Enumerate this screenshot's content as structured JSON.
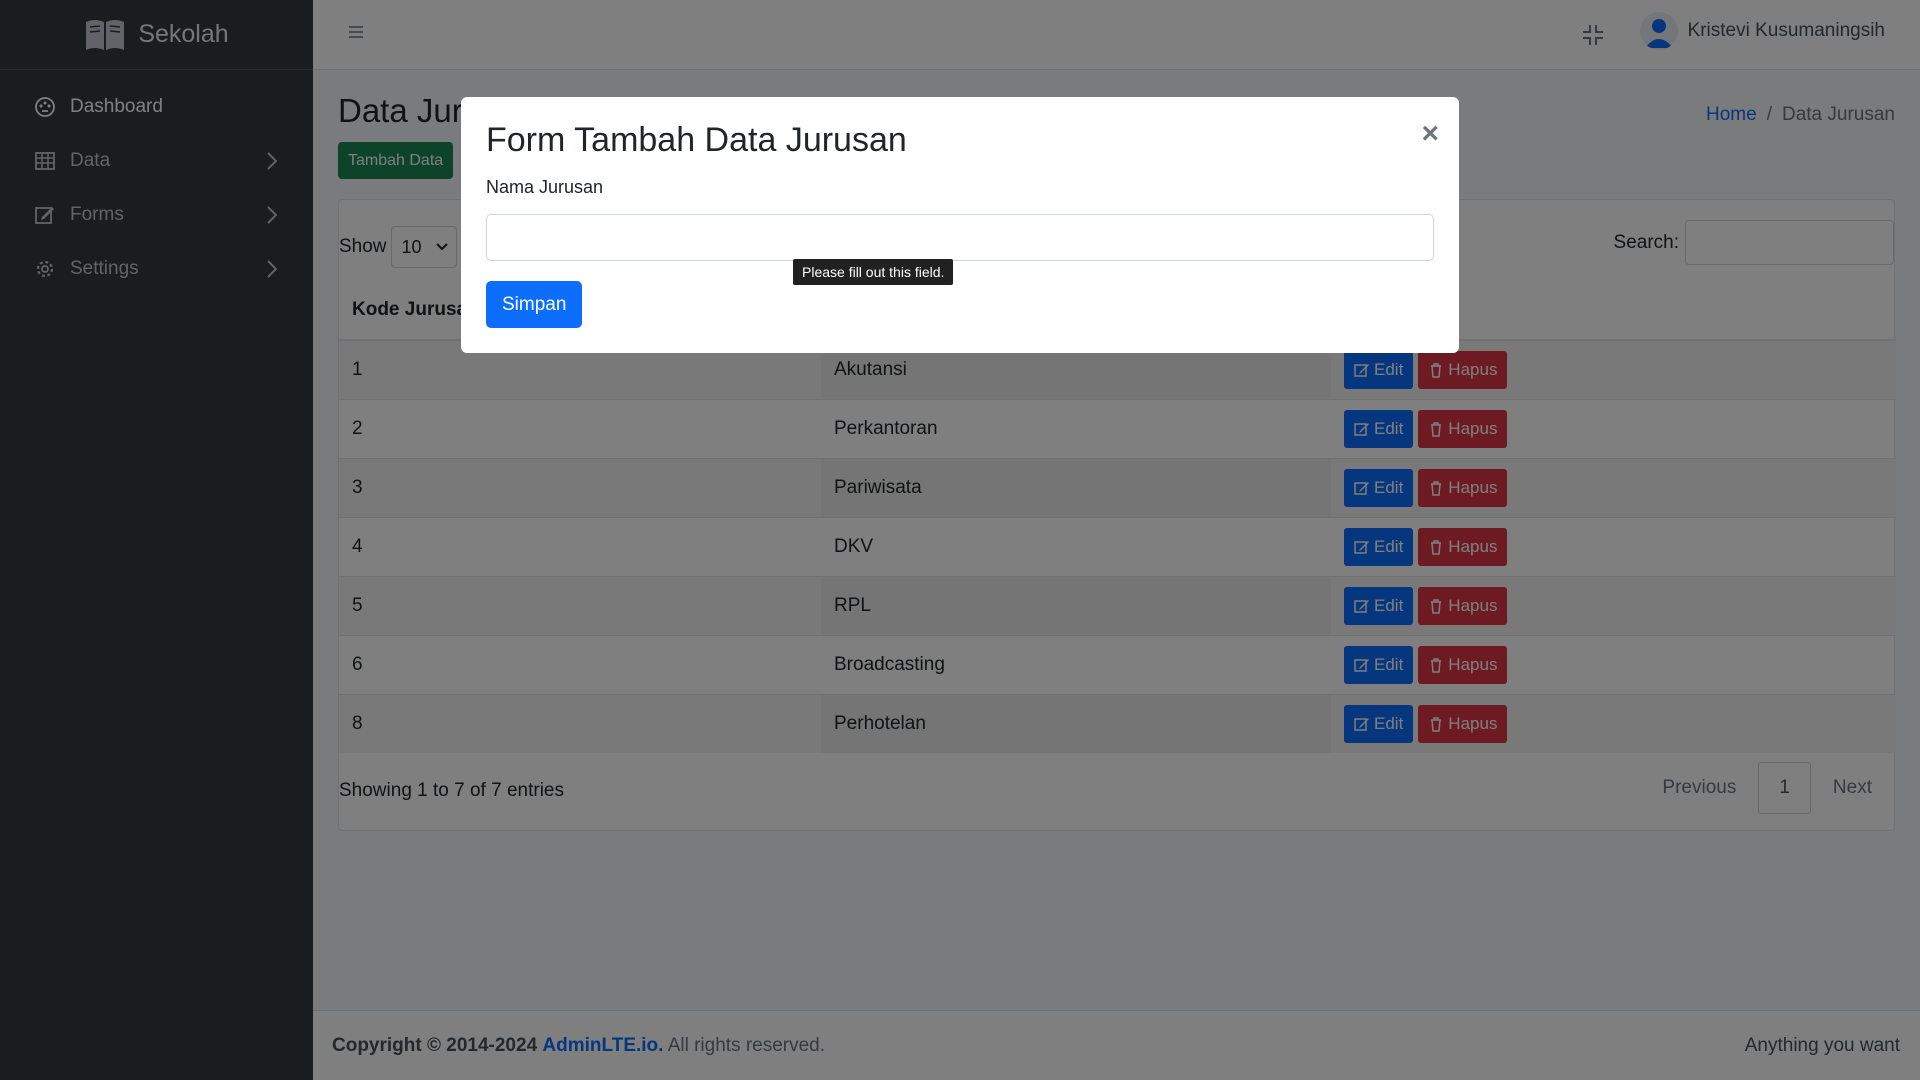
{
  "sidebar": {
    "brand": "Sekolah",
    "items": [
      {
        "label": "Dashboard"
      },
      {
        "label": "Data"
      },
      {
        "label": "Forms"
      },
      {
        "label": "Settings"
      }
    ]
  },
  "header": {
    "user_name": "Kristevi Kusumaningsih"
  },
  "page": {
    "title": "Data Jur",
    "breadcrumb": {
      "home": "Home",
      "separator": "/",
      "current": "Data Jurusan"
    },
    "add_button": "Tambah Data"
  },
  "table": {
    "show_label": "Show",
    "page_size": "10",
    "search_label": "Search:",
    "columns": [
      "Kode Jurusan"
    ],
    "edit_label": "Edit",
    "delete_label": "Hapus",
    "rows": [
      {
        "kode": "1",
        "nama": "Akutansi"
      },
      {
        "kode": "2",
        "nama": "Perkantoran"
      },
      {
        "kode": "3",
        "nama": "Pariwisata"
      },
      {
        "kode": "4",
        "nama": "DKV"
      },
      {
        "kode": "5",
        "nama": "RPL"
      },
      {
        "kode": "6",
        "nama": "Broadcasting"
      },
      {
        "kode": "8",
        "nama": "Perhotelan"
      }
    ],
    "info": "Showing 1 to 7 of 7 entries",
    "pagination": {
      "previous": "Previous",
      "current": "1",
      "next": "Next"
    }
  },
  "footer": {
    "copyright": "Copyright © 2014-2024",
    "link": "AdminLTE.io.",
    "rights": "All rights reserved.",
    "right_text": "Anything you want"
  },
  "modal": {
    "title": "Form Tambah Data Jurusan",
    "close": "×",
    "field_label": "Nama Jurusan",
    "field_value": "",
    "tooltip": "Please fill out this field.",
    "submit": "Simpan"
  }
}
